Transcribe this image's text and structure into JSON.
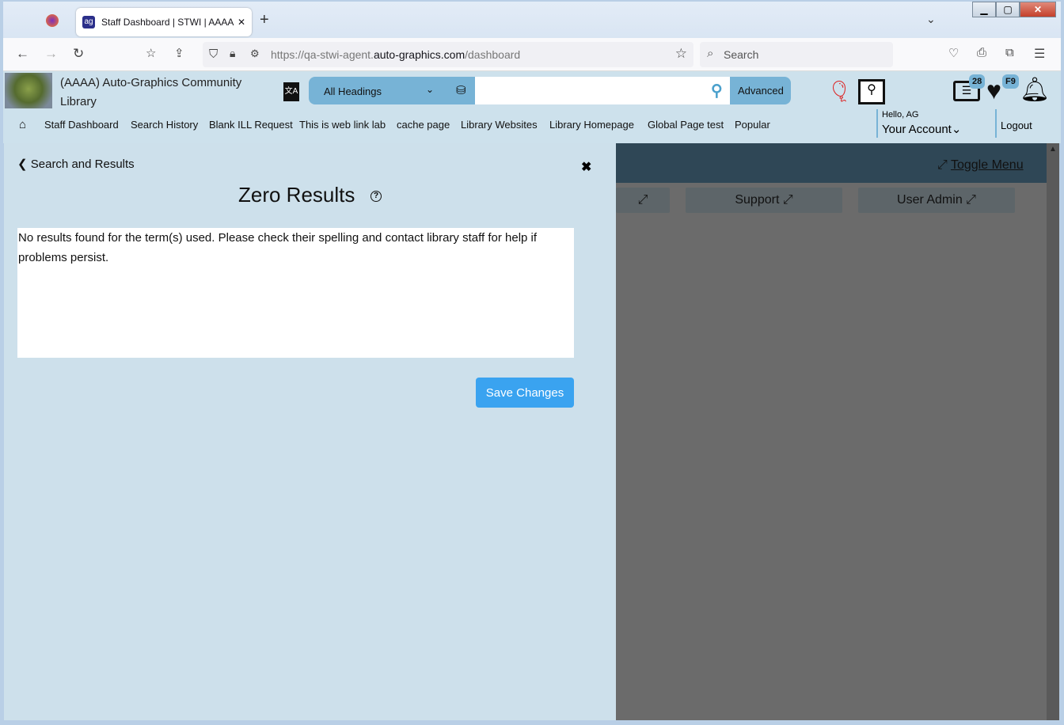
{
  "browser": {
    "tab_title": "Staff Dashboard | STWI | AAAA | S",
    "url_prefix": "https://qa-stwi-agent.",
    "url_domain": "auto-graphics.com",
    "url_path": "/dashboard",
    "search_placeholder": "Search"
  },
  "header": {
    "library_name": "(AAAA) Auto-Graphics Community Library",
    "search_scope": "All Headings",
    "search_value": "",
    "advanced_label": "Advanced",
    "list_badge": "28",
    "favorites_badge": "F9",
    "greeting": "Hello, AG",
    "account_label": "Your Account",
    "logout_label": "Logout"
  },
  "menu": [
    "Staff Dashboard",
    "Search History",
    "Blank ILL Request",
    "This is web link lab",
    "cache page",
    "Library Websites",
    "Library Homepage",
    "Global Page test",
    "Popular"
  ],
  "panel": {
    "back_label": "Search and Results",
    "title": "Zero Results",
    "message": "No results found for the term(s) used. Please check their spelling and contact library staff for help if problems persist.",
    "save_label": "Save Changes"
  },
  "dashboard": {
    "toggle_menu": "Toggle Menu",
    "buttons": [
      "Support",
      "User Admin"
    ]
  }
}
